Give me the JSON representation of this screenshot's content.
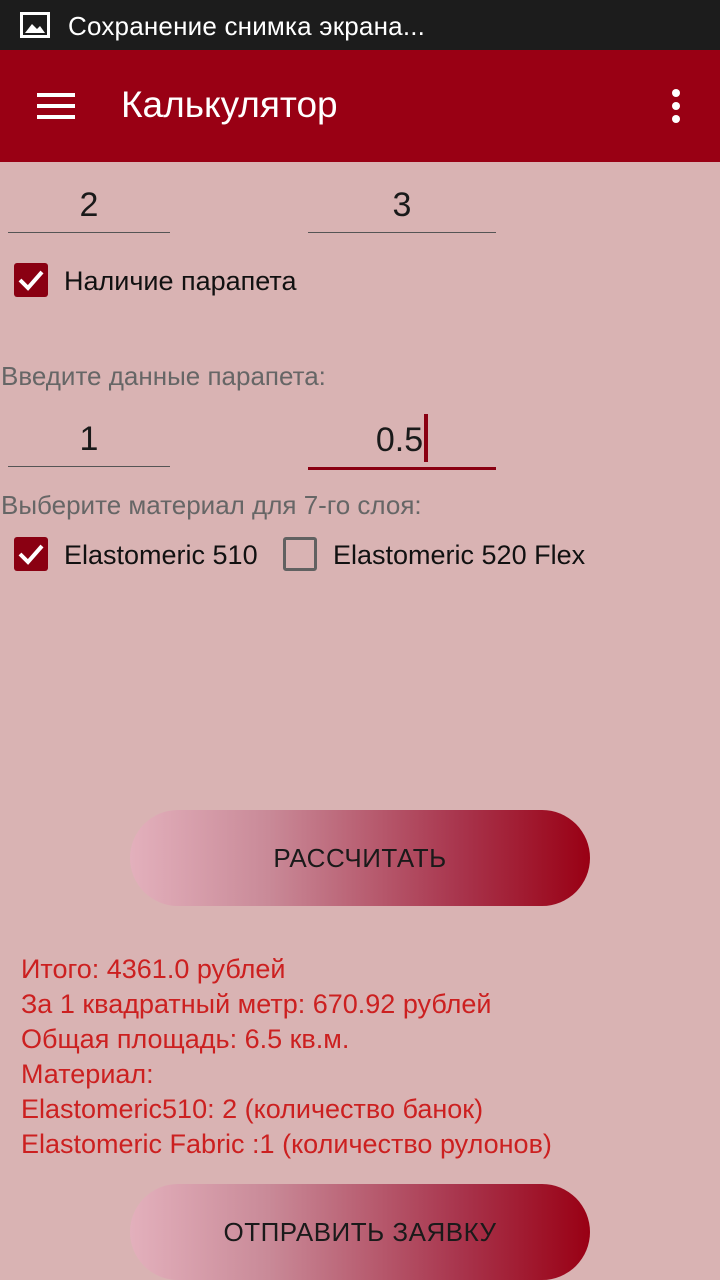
{
  "status_bar": {
    "notification_icon": "image-icon",
    "notification_text": "Сохранение снимка экрана..."
  },
  "app_bar": {
    "menu_icon": "hamburger-menu-icon",
    "title": "Калькулятор",
    "overflow_icon": "more-vert-icon",
    "color": "#990014"
  },
  "dimensions": {
    "field_1_value": "2",
    "field_2_value": "3"
  },
  "parapet": {
    "checkbox_label": "Наличие парапета",
    "checked": true,
    "section_label": "Введите данные парапета:",
    "field_1_value": "1",
    "field_2_value": "0.5"
  },
  "material": {
    "section_label": "Выберите материал для 7-го слоя:",
    "options": [
      {
        "label": "Elastomeric 510",
        "checked": true
      },
      {
        "label": "Elastomeric 520 Flex",
        "checked": false
      }
    ]
  },
  "buttons": {
    "calculate_label": "РАССЧИТАТЬ",
    "submit_label": "ОТПРАВИТЬ ЗАЯВКУ"
  },
  "results": {
    "total": "Итого: 4361.0 рублей",
    "per_sqm": "За 1 квадратный метр: 670.92 рублей",
    "area": "Общая площадь: 6.5 кв.м.",
    "material_header": "Материал:",
    "material_1": "Elastomeric510: 2 (количество банок)",
    "material_2": "Elastomeric Fabric :1 (количество рулонов)"
  },
  "colors": {
    "background": "#d9b3b3",
    "accent": "#8a0012",
    "result_text": "#cc2020"
  }
}
